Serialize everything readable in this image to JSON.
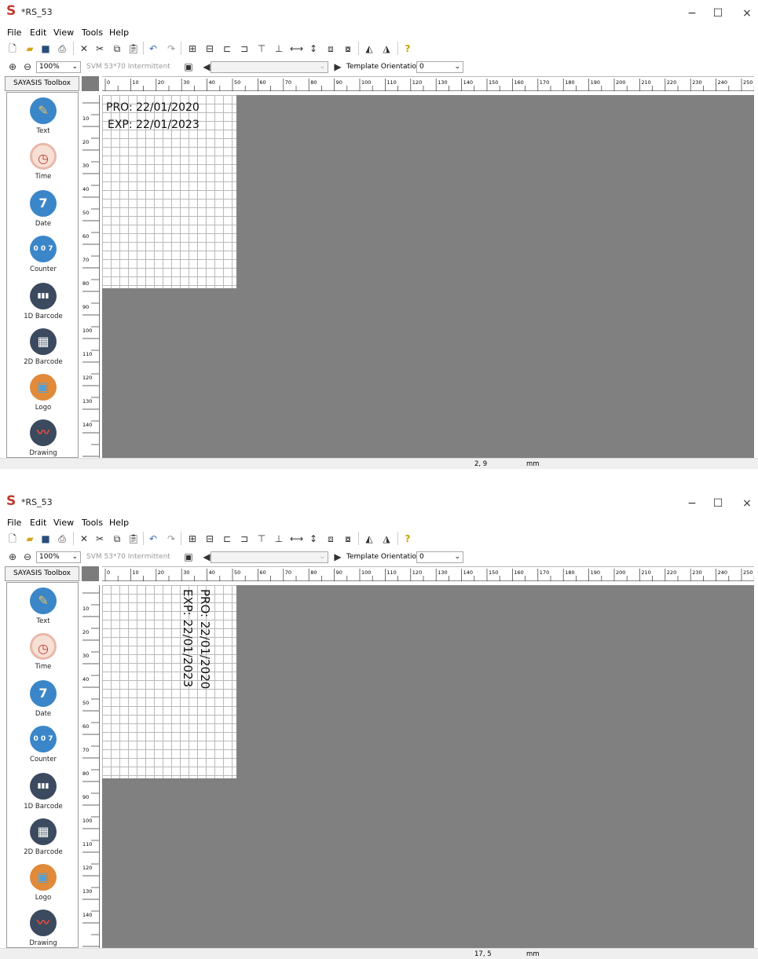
{
  "screens": [
    {
      "window": {
        "title": "*RS_53",
        "app_logo": "S",
        "minimize": "−",
        "maximize": "☐",
        "close": "×"
      },
      "menu": [
        "File",
        "Edit",
        "View",
        "Tools",
        "Help"
      ],
      "toolbar2": {
        "zoom": "100%",
        "printer": "SVM 53*70 Intermittent",
        "orientation_label": "Template Orientation",
        "orientation_value": "0"
      },
      "toolbox": {
        "header": "SAYASIS Toolbox",
        "items": [
          {
            "label": "Text",
            "icon": "text-icon"
          },
          {
            "label": "Time",
            "icon": "clock-icon"
          },
          {
            "label": "Date",
            "icon": "calendar-icon"
          },
          {
            "label": "Counter",
            "icon": "counter-icon"
          },
          {
            "label": "1D Barcode",
            "icon": "barcode-icon"
          },
          {
            "label": "2D Barcode",
            "icon": "qr-code-icon"
          },
          {
            "label": "Logo",
            "icon": "image-icon"
          },
          {
            "label": "Drawing",
            "icon": "drawing-icon"
          }
        ]
      },
      "label_text": {
        "line1": "PRO: 22/01/2020",
        "line2": "EXP: 22/01/2023",
        "orientation": "horizontal"
      },
      "status": {
        "coords": "2,  9",
        "unit": "mm"
      }
    },
    {
      "window": {
        "title": "*RS_53",
        "app_logo": "S",
        "minimize": "−",
        "maximize": "☐",
        "close": "×"
      },
      "menu": [
        "File",
        "Edit",
        "View",
        "Tools",
        "Help"
      ],
      "toolbar2": {
        "zoom": "100%",
        "printer": "SVM 53*70 Intermittent",
        "orientation_label": "Template Orientation",
        "orientation_value": "0"
      },
      "toolbox": {
        "header": "SAYASIS Toolbox",
        "items": [
          {
            "label": "Text",
            "icon": "text-icon"
          },
          {
            "label": "Time",
            "icon": "clock-icon"
          },
          {
            "label": "Date",
            "icon": "calendar-icon"
          },
          {
            "label": "Counter",
            "icon": "counter-icon"
          },
          {
            "label": "1D Barcode",
            "icon": "barcode-icon"
          },
          {
            "label": "2D Barcode",
            "icon": "qr-code-icon"
          },
          {
            "label": "Logo",
            "icon": "image-icon"
          },
          {
            "label": "Drawing",
            "icon": "drawing-icon"
          }
        ]
      },
      "label_text": {
        "line1": "PRO: 22/01/2020",
        "line2": "EXP: 22/01/2023",
        "orientation": "rotated-90"
      },
      "status": {
        "coords": "17,  5",
        "unit": "mm"
      }
    }
  ],
  "hruler_labels": [
    "0",
    "10",
    "20",
    "30",
    "40",
    "50",
    "60",
    "70",
    "80",
    "90",
    "100",
    "110",
    "120",
    "130",
    "140",
    "150",
    "160",
    "170",
    "180",
    "190",
    "200",
    "210",
    "220",
    "230",
    "240",
    "250"
  ],
  "vruler_labels_1": [
    "10",
    "20",
    "30",
    "40",
    "50",
    "60",
    "70",
    "80",
    "90",
    "100",
    "110",
    "120",
    "130",
    "140"
  ],
  "vruler_labels_2": [
    "10",
    "20",
    "30",
    "40",
    "50",
    "60",
    "70",
    "80",
    "90",
    "100",
    "110",
    "120",
    "130",
    "140"
  ],
  "colors": {
    "canvas": "#808080",
    "logo": "#c0392b",
    "tool_blue": "#3a86c8",
    "tool_orange": "#e08a3a",
    "tool_dark": "#3b4a5e"
  }
}
